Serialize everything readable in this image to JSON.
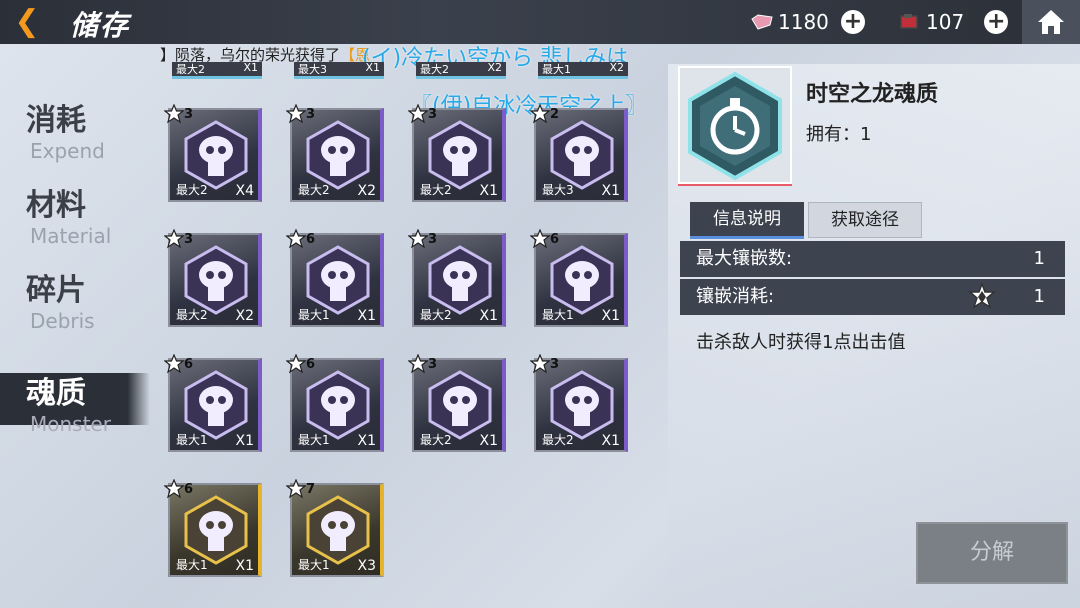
{
  "header": {
    "back_icon": "back-arrow-icon",
    "title": "储存",
    "gems": "1180",
    "stamina": "107",
    "home_icon": "home-icon"
  },
  "ticker": {
    "prefix": "】陨落，乌尔的荣光获得了",
    "highlight": "【恩"
  },
  "overlay_lyrics": {
    "line1": "(イ)冷たい空から 悲しみは",
    "line2": "〖(伊)自冰冷天空之上〗"
  },
  "categories": [
    {
      "zh": "消耗",
      "en": "Expend",
      "active": false
    },
    {
      "zh": "材料",
      "en": "Material",
      "active": false
    },
    {
      "zh": "碎片",
      "en": "Debris",
      "active": false
    },
    {
      "zh": "魂质",
      "en": "Monster",
      "active": true
    }
  ],
  "top_partial_row": [
    {
      "max": "最大2",
      "count": "X1"
    },
    {
      "max": "最大3",
      "count": "X1"
    },
    {
      "max": "最大2",
      "count": "X2"
    },
    {
      "max": "最大1",
      "count": "X2"
    }
  ],
  "items": [
    {
      "stars": "3",
      "max": "最大2",
      "count": "X4",
      "icon": "horned-mask-icon",
      "rarity": "purple"
    },
    {
      "stars": "3",
      "max": "最大2",
      "count": "X2",
      "icon": "fanged-beast-icon",
      "rarity": "purple"
    },
    {
      "stars": "3",
      "max": "最大2",
      "count": "X1",
      "icon": "crested-skull-icon",
      "rarity": "purple"
    },
    {
      "stars": "2",
      "max": "最大3",
      "count": "X1",
      "icon": "tusked-beast-icon",
      "rarity": "purple"
    },
    {
      "stars": "3",
      "max": "最大2",
      "count": "X2",
      "icon": "skull-tie-icon",
      "rarity": "purple"
    },
    {
      "stars": "6",
      "max": "最大1",
      "count": "X1",
      "icon": "shield-sword-icon",
      "rarity": "purple"
    },
    {
      "stars": "3",
      "max": "最大2",
      "count": "X1",
      "icon": "armored-beast-icon",
      "rarity": "purple"
    },
    {
      "stars": "6",
      "max": "最大1",
      "count": "X1",
      "icon": "ram-skull-icon",
      "rarity": "purple"
    },
    {
      "stars": "6",
      "max": "最大1",
      "count": "X1",
      "icon": "spider-beast-icon",
      "rarity": "purple"
    },
    {
      "stars": "6",
      "max": "最大1",
      "count": "X1",
      "icon": "curled-horn-icon",
      "rarity": "purple"
    },
    {
      "stars": "3",
      "max": "最大2",
      "count": "X1",
      "icon": "spotted-egg-icon",
      "rarity": "purple"
    },
    {
      "stars": "3",
      "max": "最大2",
      "count": "X1",
      "icon": "helmet-skull-icon",
      "rarity": "purple"
    },
    {
      "stars": "6",
      "max": "最大1",
      "count": "X1",
      "icon": "ram-skull-icon",
      "rarity": "gold"
    },
    {
      "stars": "7",
      "max": "最大1",
      "count": "X3",
      "icon": "spiky-mask-icon",
      "rarity": "gold"
    }
  ],
  "detail": {
    "icon": "stopwatch-icon",
    "name": "时空之龙魂质",
    "owned": "拥有：1",
    "tab_info": "信息说明",
    "tab_source": "获取途径",
    "max_slots_label": "最大镶嵌数:",
    "max_slots_value": "1",
    "inlay_cost_label": "镶嵌消耗:",
    "inlay_cost_value": "1",
    "description": "击杀敌人时获得1点出击值",
    "decompose_button": "分解"
  },
  "colors": {
    "accent": "#f39a1e",
    "purple_border": "#7b5cc9",
    "gold_border": "#e6b42a",
    "overlay_text": "#2aa9e8"
  }
}
